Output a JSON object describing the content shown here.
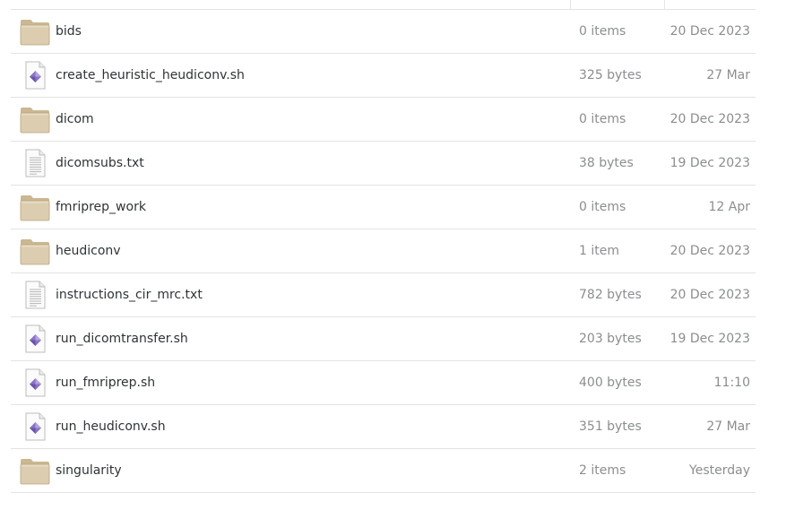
{
  "file_list": {
    "rows": [
      {
        "name": "bids",
        "size": "0 items",
        "modified": "20 Dec 2023",
        "icon": "folder-icon"
      },
      {
        "name": "create_heuristic_heudiconv.sh",
        "size": "325 bytes",
        "modified": "27 Mar",
        "icon": "script-file-icon"
      },
      {
        "name": "dicom",
        "size": "0 items",
        "modified": "20 Dec 2023",
        "icon": "folder-icon"
      },
      {
        "name": "dicomsubs.txt",
        "size": "38 bytes",
        "modified": "19 Dec 2023",
        "icon": "text-file-icon"
      },
      {
        "name": "fmriprep_work",
        "size": "0 items",
        "modified": "12 Apr",
        "icon": "folder-icon"
      },
      {
        "name": "heudiconv",
        "size": "1 item",
        "modified": "20 Dec 2023",
        "icon": "folder-icon"
      },
      {
        "name": "instructions_cir_mrc.txt",
        "size": "782 bytes",
        "modified": "20 Dec 2023",
        "icon": "text-file-icon"
      },
      {
        "name": "run_dicomtransfer.sh",
        "size": "203 bytes",
        "modified": "19 Dec 2023",
        "icon": "script-file-icon"
      },
      {
        "name": "run_fmriprep.sh",
        "size": "400 bytes",
        "modified": "11:10",
        "icon": "script-file-icon"
      },
      {
        "name": "run_heudiconv.sh",
        "size": "351 bytes",
        "modified": "27 Mar",
        "icon": "script-file-icon"
      },
      {
        "name": "singularity",
        "size": "2 items",
        "modified": "Yesterday",
        "icon": "folder-icon"
      }
    ]
  },
  "colors": {
    "text": "#2e3436",
    "muted": "#8b8e8f",
    "divider": "#e3e3e3",
    "folder_body": "#dccdb0",
    "folder_tab": "#cbb791",
    "script_diamond": "#8a72c9"
  }
}
